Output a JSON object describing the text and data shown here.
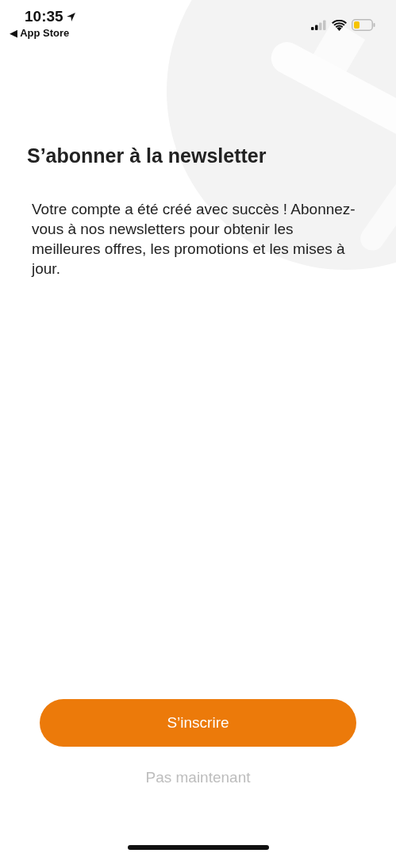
{
  "status_bar": {
    "time": "10:35",
    "back_label": "◀ App Store"
  },
  "title": "S’abonner à la newsletter",
  "message": "Votre compte a été créé avec succès ! Abonnez-vous à nos newsletters pour obtenir les meilleures offres, les promotions et les mises à jour.",
  "buttons": [
    {
      "kind": "primary",
      "label": "S’inscrire"
    },
    {
      "kind": "secondary",
      "label": "Pas maintenant"
    }
  ]
}
